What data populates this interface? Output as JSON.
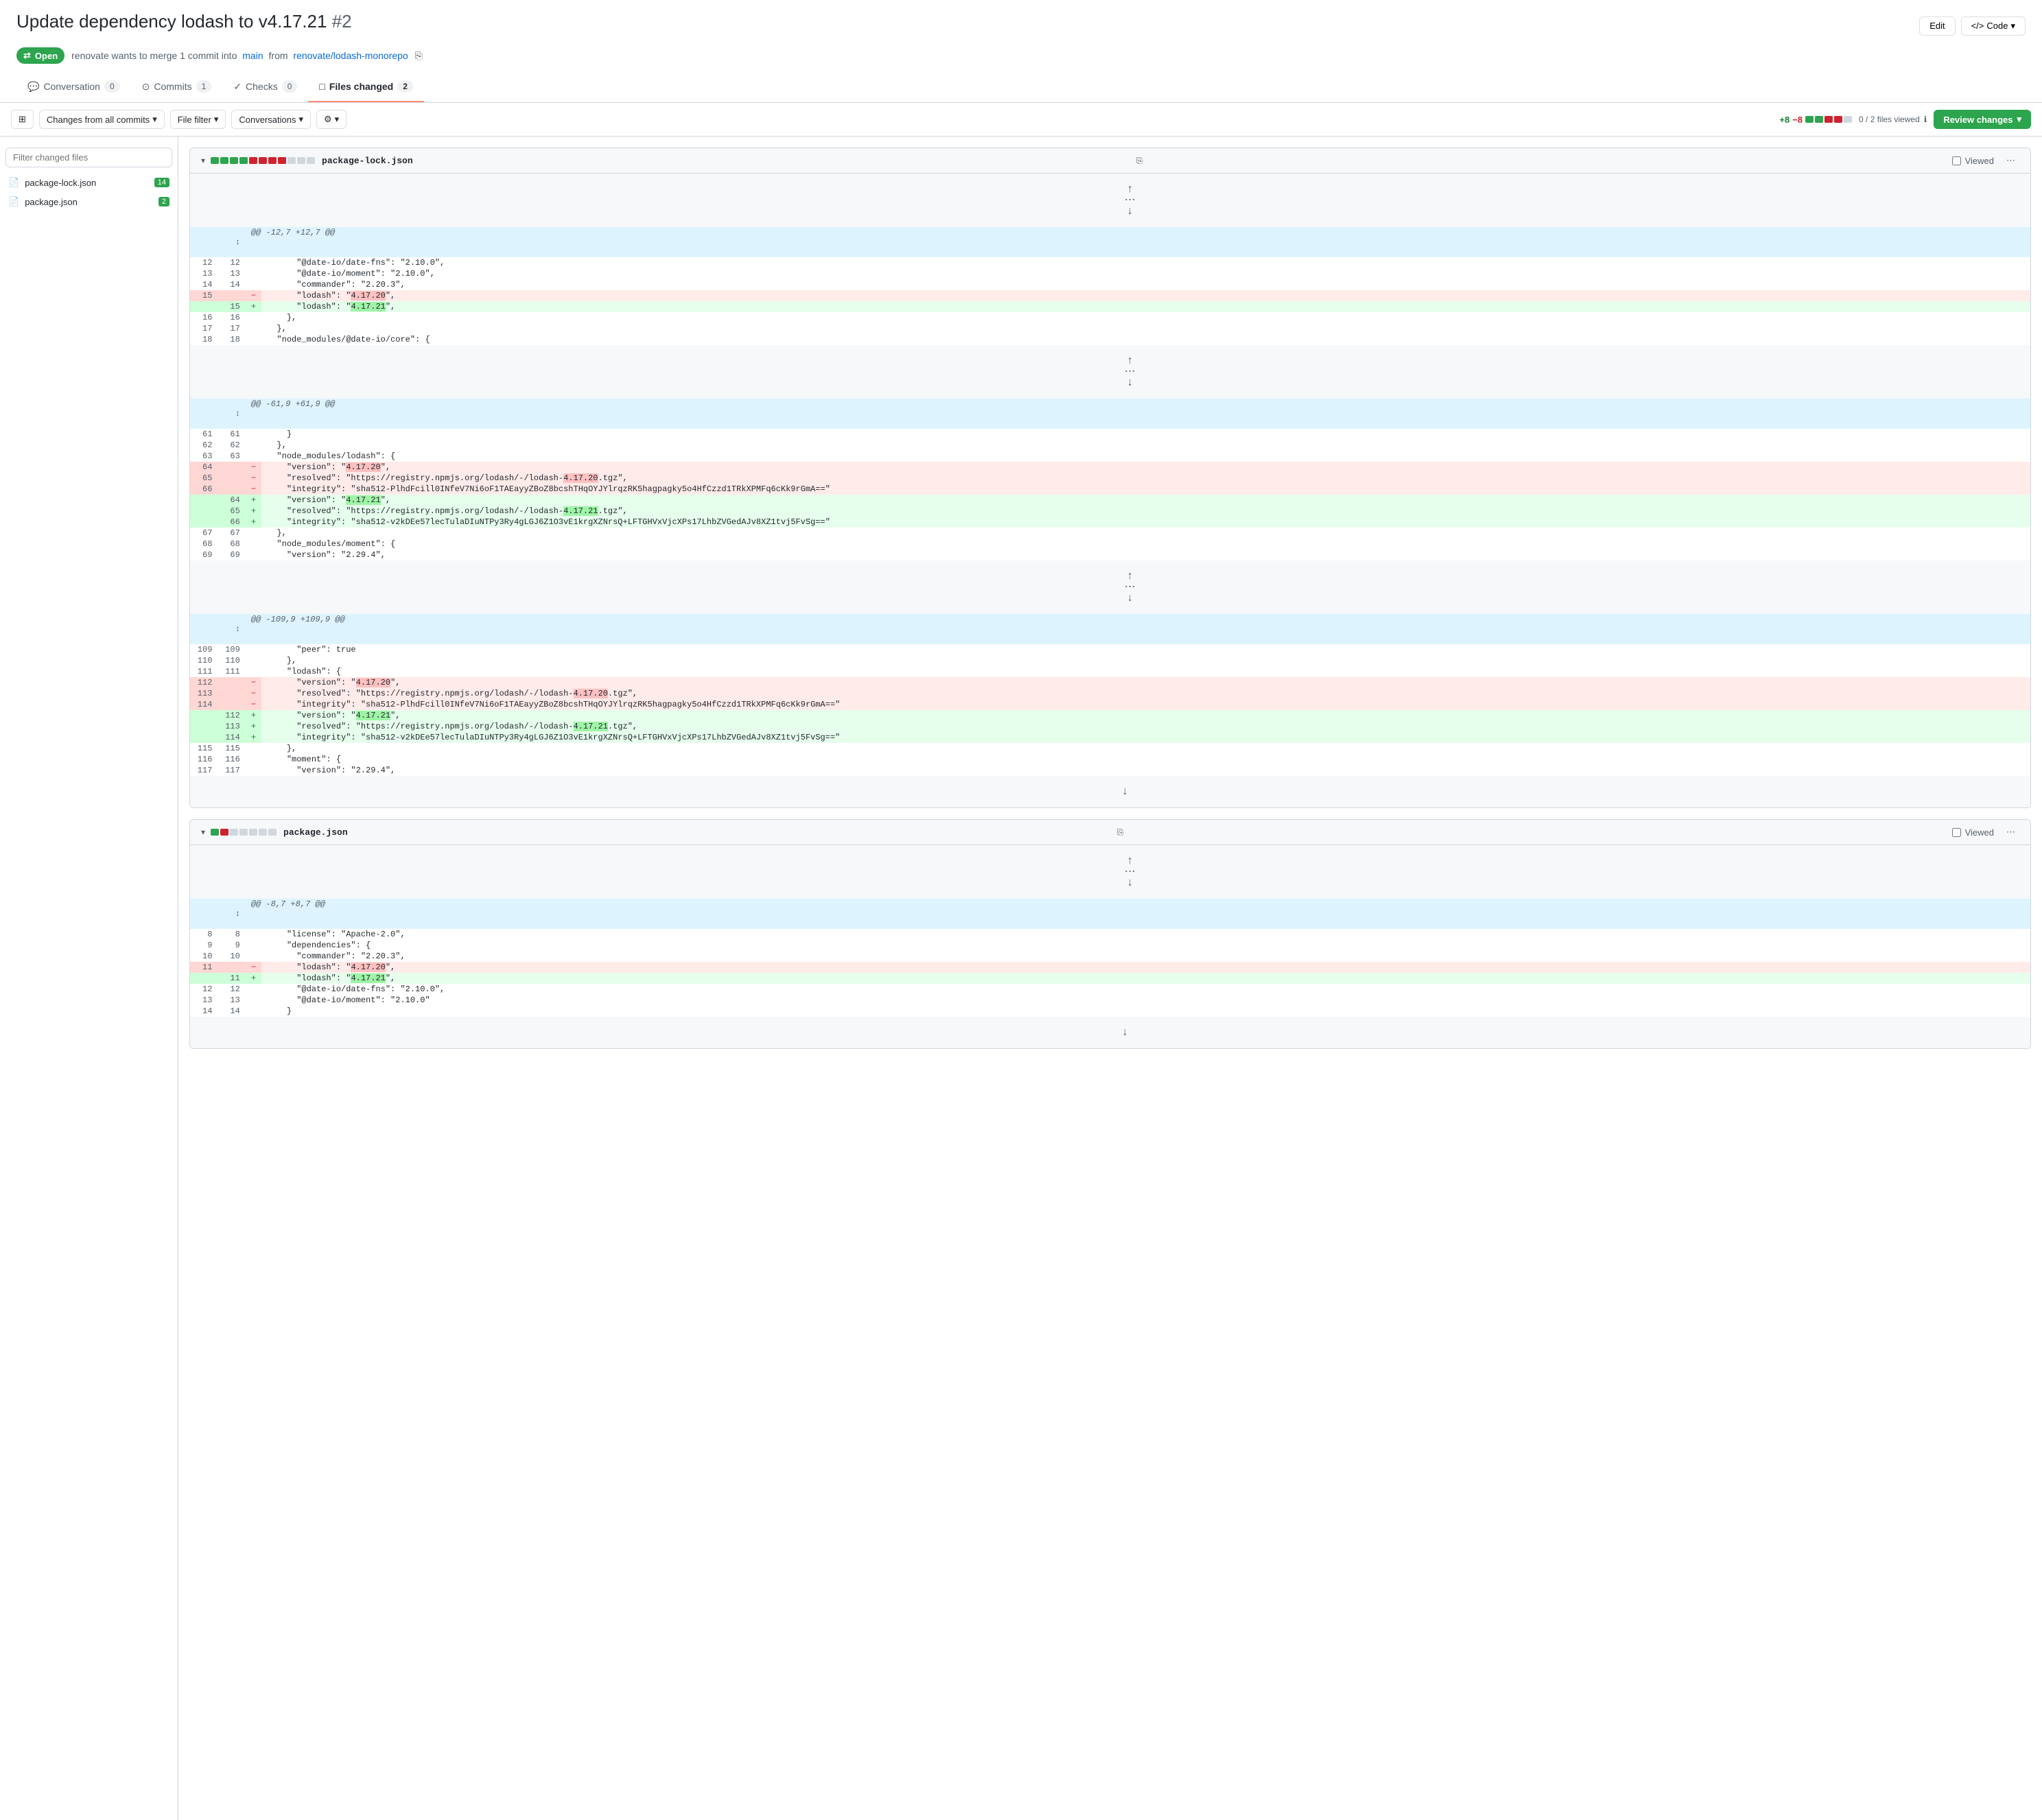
{
  "page": {
    "title": "Update dependency lodash to v4.17.21",
    "pr_number": "#2",
    "edit_label": "Edit",
    "code_label": "Code"
  },
  "pr_meta": {
    "status": "Open",
    "description": "renovate wants to merge 1 commit into",
    "base_branch": "main",
    "from_text": "from",
    "head_branch": "renovate/lodash-monorepo",
    "copy_title": "Copy branch name"
  },
  "tabs": [
    {
      "id": "conversation",
      "label": "Conversation",
      "count": "0",
      "icon": "💬"
    },
    {
      "id": "commits",
      "label": "Commits",
      "count": "1",
      "icon": "⊙"
    },
    {
      "id": "checks",
      "label": "Checks",
      "count": "0",
      "icon": "✓"
    },
    {
      "id": "files_changed",
      "label": "Files changed",
      "count": "2",
      "icon": "□",
      "active": true
    }
  ],
  "toolbar": {
    "diff_add": "+8",
    "diff_del": "−8",
    "diff_blocks": [
      "add",
      "add",
      "del",
      "del",
      "neutral"
    ],
    "changes_from": "Changes from all commits",
    "file_filter": "File filter",
    "conversations": "Conversations",
    "settings_icon": "⚙",
    "files_viewed": "0 / 2 files viewed",
    "review_changes": "Review changes"
  },
  "sidebar": {
    "filter_placeholder": "Filter changed files",
    "files": [
      {
        "name": "package-lock.json",
        "added": "14"
      },
      {
        "name": "package.json",
        "added": "2"
      }
    ]
  },
  "diff_files": [
    {
      "id": "package-lock-json",
      "name": "package-lock.json",
      "stat_adds": 4,
      "stat_dels": 4,
      "stat_neutral": 3,
      "viewed_label": "Viewed",
      "hunks": [
        {
          "header": "@@ -12,7 +12,7 @@",
          "lines": [
            {
              "type": "context",
              "left_num": "12",
              "right_num": "12",
              "code": "      \"@date-io/date-fns\": \"2.10.0\","
            },
            {
              "type": "context",
              "left_num": "13",
              "right_num": "13",
              "code": "      \"@date-io/moment\": \"2.10.0\","
            },
            {
              "type": "context",
              "left_num": "14",
              "right_num": "14",
              "code": "      \"commander\": \"2.20.3\","
            },
            {
              "type": "del",
              "left_num": "15",
              "right_num": "",
              "code": "      \"lodash\": \"4.17.20\","
            },
            {
              "type": "add",
              "left_num": "",
              "right_num": "15",
              "code": "      \"lodash\": \"4.17.21\","
            },
            {
              "type": "context",
              "left_num": "16",
              "right_num": "16",
              "code": "    },"
            },
            {
              "type": "context",
              "left_num": "17",
              "right_num": "17",
              "code": "  },"
            },
            {
              "type": "context",
              "left_num": "18",
              "right_num": "18",
              "code": "  \"node_modules/@date-io/core\": {"
            }
          ]
        },
        {
          "header": "@@ -61,9 +61,9 @@",
          "lines": [
            {
              "type": "context",
              "left_num": "61",
              "right_num": "61",
              "code": "    }"
            },
            {
              "type": "context",
              "left_num": "62",
              "right_num": "62",
              "code": "  },"
            },
            {
              "type": "context",
              "left_num": "63",
              "right_num": "63",
              "code": "  \"node_modules/lodash\": {"
            },
            {
              "type": "del",
              "left_num": "64",
              "right_num": "",
              "code": "    \"version\": \"4.17.20\","
            },
            {
              "type": "del",
              "left_num": "65",
              "right_num": "",
              "code": "    \"resolved\": \"https://registry.npmjs.org/lodash/-/lodash-4.17.20.tgz\","
            },
            {
              "type": "del",
              "left_num": "66",
              "right_num": "",
              "code": "    \"integrity\": \"sha512-PlhdFcill0INfeV7Ni6oF1TAEayyZBoZ8bcshTHqOYJYlrqzRK5hagpagky5o4HfCzzd1TRkXPMFq6cKk9rGmA==\""
            },
            {
              "type": "add",
              "left_num": "",
              "right_num": "64",
              "code": "    \"version\": \"4.17.21\","
            },
            {
              "type": "add",
              "left_num": "",
              "right_num": "65",
              "code": "    \"resolved\": \"https://registry.npmjs.org/lodash/-/lodash-4.17.21.tgz\","
            },
            {
              "type": "add",
              "left_num": "",
              "right_num": "66",
              "code": "    \"integrity\": \"sha512-v2kDEe57lecTulaDIuNTPy3Ry4gLGJ6Z1O3vE1krgXZNrsQ+LFTGHVxVjcXPs17LhbZVGedAJv8XZ1tvj5FvSg==\""
            },
            {
              "type": "context",
              "left_num": "67",
              "right_num": "67",
              "code": "  },"
            },
            {
              "type": "context",
              "left_num": "68",
              "right_num": "68",
              "code": "  \"node_modules/moment\": {"
            },
            {
              "type": "context",
              "left_num": "69",
              "right_num": "69",
              "code": "    \"version\": \"2.29.4\","
            }
          ]
        },
        {
          "header": "@@ -109,9 +109,9 @@",
          "lines": [
            {
              "type": "context",
              "left_num": "109",
              "right_num": "109",
              "code": "      \"peer\": true"
            },
            {
              "type": "context",
              "left_num": "110",
              "right_num": "110",
              "code": "    },"
            },
            {
              "type": "context",
              "left_num": "111",
              "right_num": "111",
              "code": "    \"lodash\": {"
            },
            {
              "type": "del",
              "left_num": "112",
              "right_num": "",
              "code": "      \"version\": \"4.17.20\","
            },
            {
              "type": "del",
              "left_num": "113",
              "right_num": "",
              "code": "      \"resolved\": \"https://registry.npmjs.org/lodash/-/lodash-4.17.20.tgz\","
            },
            {
              "type": "del",
              "left_num": "114",
              "right_num": "",
              "code": "      \"integrity\": \"sha512-PlhdFcill0INfeV7Ni6oF1TAEayyZBoZ8bcshTHqOYJYlrqzRK5hagpagky5o4HfCzzd1TRkXPMFq6cKk9rGmA==\""
            },
            {
              "type": "add",
              "left_num": "",
              "right_num": "112",
              "code": "      \"version\": \"4.17.21\","
            },
            {
              "type": "add",
              "left_num": "",
              "right_num": "113",
              "code": "      \"resolved\": \"https://registry.npmjs.org/lodash/-/lodash-4.17.21.tgz\","
            },
            {
              "type": "add",
              "left_num": "",
              "right_num": "114",
              "code": "      \"integrity\": \"sha512-v2kDEe57lecTulaDIuNTPy3Ry4gLGJ6Z1O3vE1krgXZNrsQ+LFTGHVxVjcXPs17LhbZVGedAJv8XZ1tvj5FvSg==\""
            },
            {
              "type": "context",
              "left_num": "115",
              "right_num": "115",
              "code": "    },"
            },
            {
              "type": "context",
              "left_num": "116",
              "right_num": "116",
              "code": "    \"moment\": {"
            },
            {
              "type": "context",
              "left_num": "117",
              "right_num": "117",
              "code": "      \"version\": \"2.29.4\","
            }
          ]
        }
      ]
    },
    {
      "id": "package-json",
      "name": "package.json",
      "stat_adds": 1,
      "stat_dels": 1,
      "stat_neutral": 5,
      "viewed_label": "Viewed",
      "hunks": [
        {
          "header": "@@ -8,7 +8,7 @@",
          "lines": [
            {
              "type": "context",
              "left_num": "8",
              "right_num": "8",
              "code": "    \"license\": \"Apache-2.0\","
            },
            {
              "type": "context",
              "left_num": "9",
              "right_num": "9",
              "code": "    \"dependencies\": {"
            },
            {
              "type": "context",
              "left_num": "10",
              "right_num": "10",
              "code": "      \"commander\": \"2.20.3\","
            },
            {
              "type": "del",
              "left_num": "11",
              "right_num": "",
              "code": "      \"lodash\": \"4.17.20\","
            },
            {
              "type": "add",
              "left_num": "",
              "right_num": "11",
              "code": "      \"lodash\": \"4.17.21\","
            },
            {
              "type": "context",
              "left_num": "12",
              "right_num": "12",
              "code": "      \"@date-io/date-fns\": \"2.10.0\","
            },
            {
              "type": "context",
              "left_num": "13",
              "right_num": "13",
              "code": "      \"@date-io/moment\": \"2.10.0\""
            },
            {
              "type": "context",
              "left_num": "14",
              "right_num": "14",
              "code": "    }"
            }
          ]
        }
      ]
    }
  ]
}
